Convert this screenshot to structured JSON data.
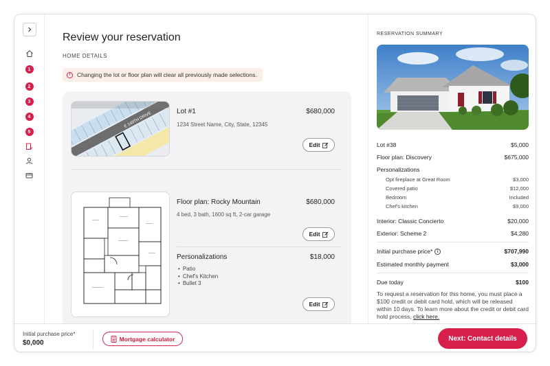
{
  "main": {
    "title": "Review your reservation",
    "section_label": "HOME DETAILS",
    "notice": "Changing the lot or floor plan will clear all previously made selections.",
    "edit_label": "Edit",
    "lot": {
      "title": "Lot #1",
      "price": "$680,000",
      "address": "1234 Street Name, City, State, 12345",
      "map_street": "E 149TH DRIVE"
    },
    "floorplan": {
      "title": "Floor plan: Rocky Mountain",
      "price": "$680,000",
      "details": "4 bed, 3 bath, 1600 sq ft, 2-car garage"
    },
    "personalizations": {
      "title": "Personalizations",
      "price": "$18,000",
      "bullets": [
        "Patio",
        "Chef's Kitchen",
        "Bullet 3"
      ]
    }
  },
  "summary": {
    "label": "RESERVATION SUMMARY",
    "lot": {
      "label": "Lot #38",
      "value": "$5,000"
    },
    "floorplan": {
      "label": "Floor plan: Discovery",
      "value": "$675,000"
    },
    "personalizations_label": "Personalizations",
    "personalizations": [
      {
        "label": "Opt fireplace at Great Room",
        "value": "$3,000"
      },
      {
        "label": "Covered patio",
        "value": "$12,000"
      },
      {
        "label": "Bedroom",
        "value": "Included"
      },
      {
        "label": "Chef's kitchen",
        "value": "$9,000"
      }
    ],
    "interior": {
      "label": "Interior: Classic Concierto",
      "value": "$20,000"
    },
    "exterior": {
      "label": "Exterior: Scheme 2",
      "value": "$4,280"
    },
    "initial_price": {
      "label": "Initial purchase price*",
      "value": "$707,990"
    },
    "monthly": {
      "label": "Estimated monthly payment",
      "value": "$3,000"
    },
    "due_today": {
      "label": "Due today",
      "value": "$100"
    },
    "due_note": "To request a reservation for this home, you must place a $100 credit or debit card hold, which will be released within 10 days. To learn more about the credit or debit card hold process,",
    "due_link": "click here."
  },
  "rail": {
    "steps": [
      "1",
      "2",
      "3",
      "4",
      "5"
    ]
  },
  "footer": {
    "price_label": "Initial purchase price*",
    "price_value": "$0,000",
    "mortgage_label": "Mortgage calculator",
    "next_label": "Next: Contact details"
  },
  "colors": {
    "accent": "#d61f4b",
    "notice_bg": "#fbeee9",
    "panel_bg": "#f3f3f5"
  }
}
